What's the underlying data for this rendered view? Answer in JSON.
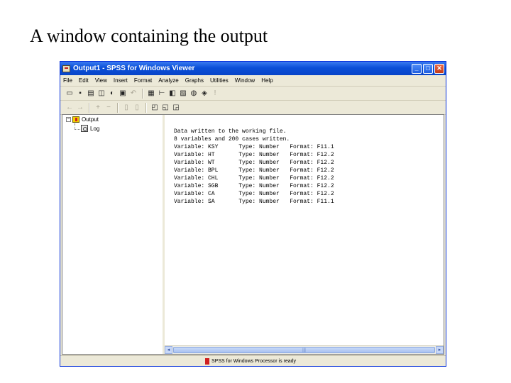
{
  "slide": {
    "title": "A window containing the output"
  },
  "window": {
    "title": "Output1 - SPSS for Windows Viewer",
    "controls": {
      "minimize": "_",
      "maximize": "□",
      "close": "✕"
    }
  },
  "menubar": {
    "items": [
      "File",
      "Edit",
      "View",
      "Insert",
      "Format",
      "Analyze",
      "Graphs",
      "Utilities",
      "Window",
      "Help"
    ]
  },
  "toolbar1": {
    "icons": [
      "open-icon",
      "save-icon",
      "print-icon",
      "print-preview-icon",
      "export-icon",
      "recall-dialog-icon",
      "undo-icon",
      "goto-data-icon",
      "goto-case-icon",
      "variables-icon",
      "find-icon",
      "designate-window-icon",
      "select-last-output-icon"
    ]
  },
  "toolbar2": {
    "icons": [
      "promote-icon",
      "demote-icon",
      "expand-icon",
      "collapse-icon",
      "show-icon",
      "hide-icon",
      "insert-heading-icon",
      "insert-title-icon",
      "insert-text-icon"
    ]
  },
  "outline": {
    "root": {
      "toggle": "−",
      "label": "Output"
    },
    "children": [
      {
        "label": "Log"
      }
    ]
  },
  "log": {
    "lines": [
      "Data written to the working file.",
      "8 variables and 200 cases written.",
      "Variable: KSY      Type: Number   Format: F11.1",
      "Variable: HT       Type: Number   Format: F12.2",
      "Variable: WT       Type: Number   Format: F12.2",
      "Variable: BPL      Type: Number   Format: F12.2",
      "Variable: CHL      Type: Number   Format: F12.2",
      "Variable: SGB      Type: Number   Format: F12.2",
      "Variable: CA       Type: Number   Format: F12.2",
      "Variable: SA       Type: Number   Format: F11.1"
    ]
  },
  "status": {
    "text": "SPSS for Windows Processor is ready"
  },
  "scrollbar": {
    "left": "◂",
    "right": "▸",
    "grip": "|||"
  }
}
